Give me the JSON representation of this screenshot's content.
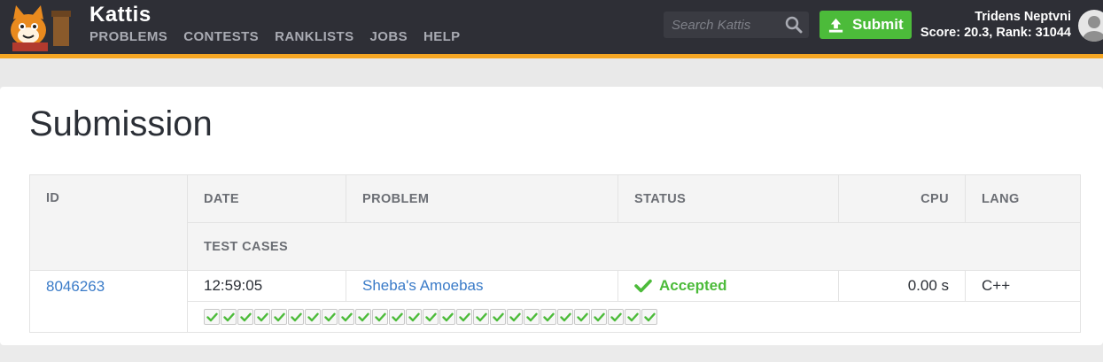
{
  "header": {
    "brand": "Kattis",
    "nav": [
      "PROBLEMS",
      "CONTESTS",
      "RANKLISTS",
      "JOBS",
      "HELP"
    ],
    "search_placeholder": "Search Kattis",
    "submit_label": "Submit",
    "user_name": "Tridens Neptvni",
    "user_stats": "Score: 20.3, Rank: 31044",
    "accent_color": "#f5a623"
  },
  "page": {
    "title": "Submission"
  },
  "table": {
    "headers": {
      "id": "ID",
      "date": "DATE",
      "problem": "PROBLEM",
      "status": "STATUS",
      "cpu": "CPU",
      "lang": "LANG",
      "test_cases": "TEST CASES"
    },
    "row": {
      "id": "8046263",
      "date": "12:59:05",
      "problem": "Sheba's Amoebas",
      "status": "Accepted",
      "cpu": "0.00 s",
      "lang": "C++"
    },
    "test_cases_passed": 27,
    "status_color": "#4cbb3a"
  }
}
